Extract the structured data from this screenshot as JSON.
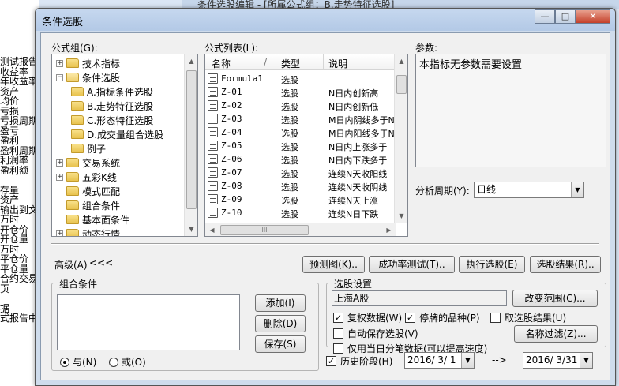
{
  "background": {
    "left_lines": [
      "测试报告",
      "收益率",
      "年收益率",
      "资产",
      "均价",
      "亏损",
      "亏损周期",
      "盈亏",
      "盈利",
      "盈利周期",
      "利润率",
      "盈利额",
      "",
      "存量",
      "资产",
      "输出到文",
      "万时",
      "开仓价",
      "开仓量",
      "万时",
      "平仓价",
      "平仓量",
      "合约交易",
      "页",
      "",
      "据",
      "式报告中"
    ],
    "top_text": "条件选股编辑 - [所属公式组：B.走势特征选股]"
  },
  "dialog": {
    "title": "条件选股",
    "minimize": "—",
    "maximize": "□",
    "close": "✕"
  },
  "formula_group": {
    "label": "公式组(G):",
    "items": [
      {
        "label": "技术指标",
        "toggle": "+"
      },
      {
        "label": "条件选股",
        "toggle": "−"
      },
      {
        "label": "A.指标条件选股"
      },
      {
        "label": "B.走势特征选股"
      },
      {
        "label": "C.形态特征选股"
      },
      {
        "label": "D.成交量组合选股"
      },
      {
        "label": "例子"
      },
      {
        "label": "交易系统",
        "toggle": "+"
      },
      {
        "label": "五彩K线",
        "toggle": "+"
      },
      {
        "label": "模式匹配"
      },
      {
        "label": "组合条件"
      },
      {
        "label": "基本面条件"
      },
      {
        "label": "动态行情",
        "toggle": "+"
      }
    ]
  },
  "formula_list": {
    "label": "公式列表(L):",
    "columns": [
      "名称",
      "/",
      "类型",
      "说明"
    ],
    "rows": [
      {
        "name": "Formula1",
        "type": "选股",
        "desc": ""
      },
      {
        "name": "Z-01",
        "type": "选股",
        "desc": "N日内创新高"
      },
      {
        "name": "Z-02",
        "type": "选股",
        "desc": "N日内创新低"
      },
      {
        "name": "Z-03",
        "type": "选股",
        "desc": "M日内阴线多于N"
      },
      {
        "name": "Z-04",
        "type": "选股",
        "desc": "M日内阳线多于N"
      },
      {
        "name": "Z-05",
        "type": "选股",
        "desc": "N日内上涨多于"
      },
      {
        "name": "Z-06",
        "type": "选股",
        "desc": "N日内下跌多于"
      },
      {
        "name": "Z-07",
        "type": "选股",
        "desc": "连续N天收阳线"
      },
      {
        "name": "Z-08",
        "type": "选股",
        "desc": "连续N天收阴线"
      },
      {
        "name": "Z-09",
        "type": "选股",
        "desc": "连续N天上涨"
      },
      {
        "name": "Z-10",
        "type": "选股",
        "desc": "连续N日下跌"
      }
    ],
    "hscroll_grip": "III"
  },
  "params": {
    "label": "参数:",
    "text": "本指标无参数需要设置"
  },
  "period": {
    "label": "分析周期(Y):",
    "value": "日线"
  },
  "actions": {
    "advanced": "高级(A)",
    "advanced_arrows": "<<<",
    "preview": "预测图(K)..",
    "success_test": "成功率测试(T)..",
    "execute": "执行选股(E)",
    "results": "选股结果(R).."
  },
  "combo_conditions": {
    "title": "组合条件",
    "add": "添加(I)",
    "delete": "删除(D)",
    "save": "保存(S)",
    "and_label": "与(N)",
    "or_label": "或(O)"
  },
  "settings": {
    "title": "选股设置",
    "scope_value": "上海A股",
    "change_scope": "改变范围(C)...",
    "restore_rights": "复权数据(W)",
    "suspended": "停牌的品种(P)",
    "cancel_results": "取选股结果(U)",
    "auto_save": "自动保存选股(V)",
    "name_filter": "名称过滤(Z)...",
    "today_only": "仅用当日分笔数据(可以提高速度)",
    "history": "历史阶段(H)",
    "date_from": "2016/ 3/ 1",
    "arrow": "-->",
    "date_to": "2016/ 3/31"
  }
}
